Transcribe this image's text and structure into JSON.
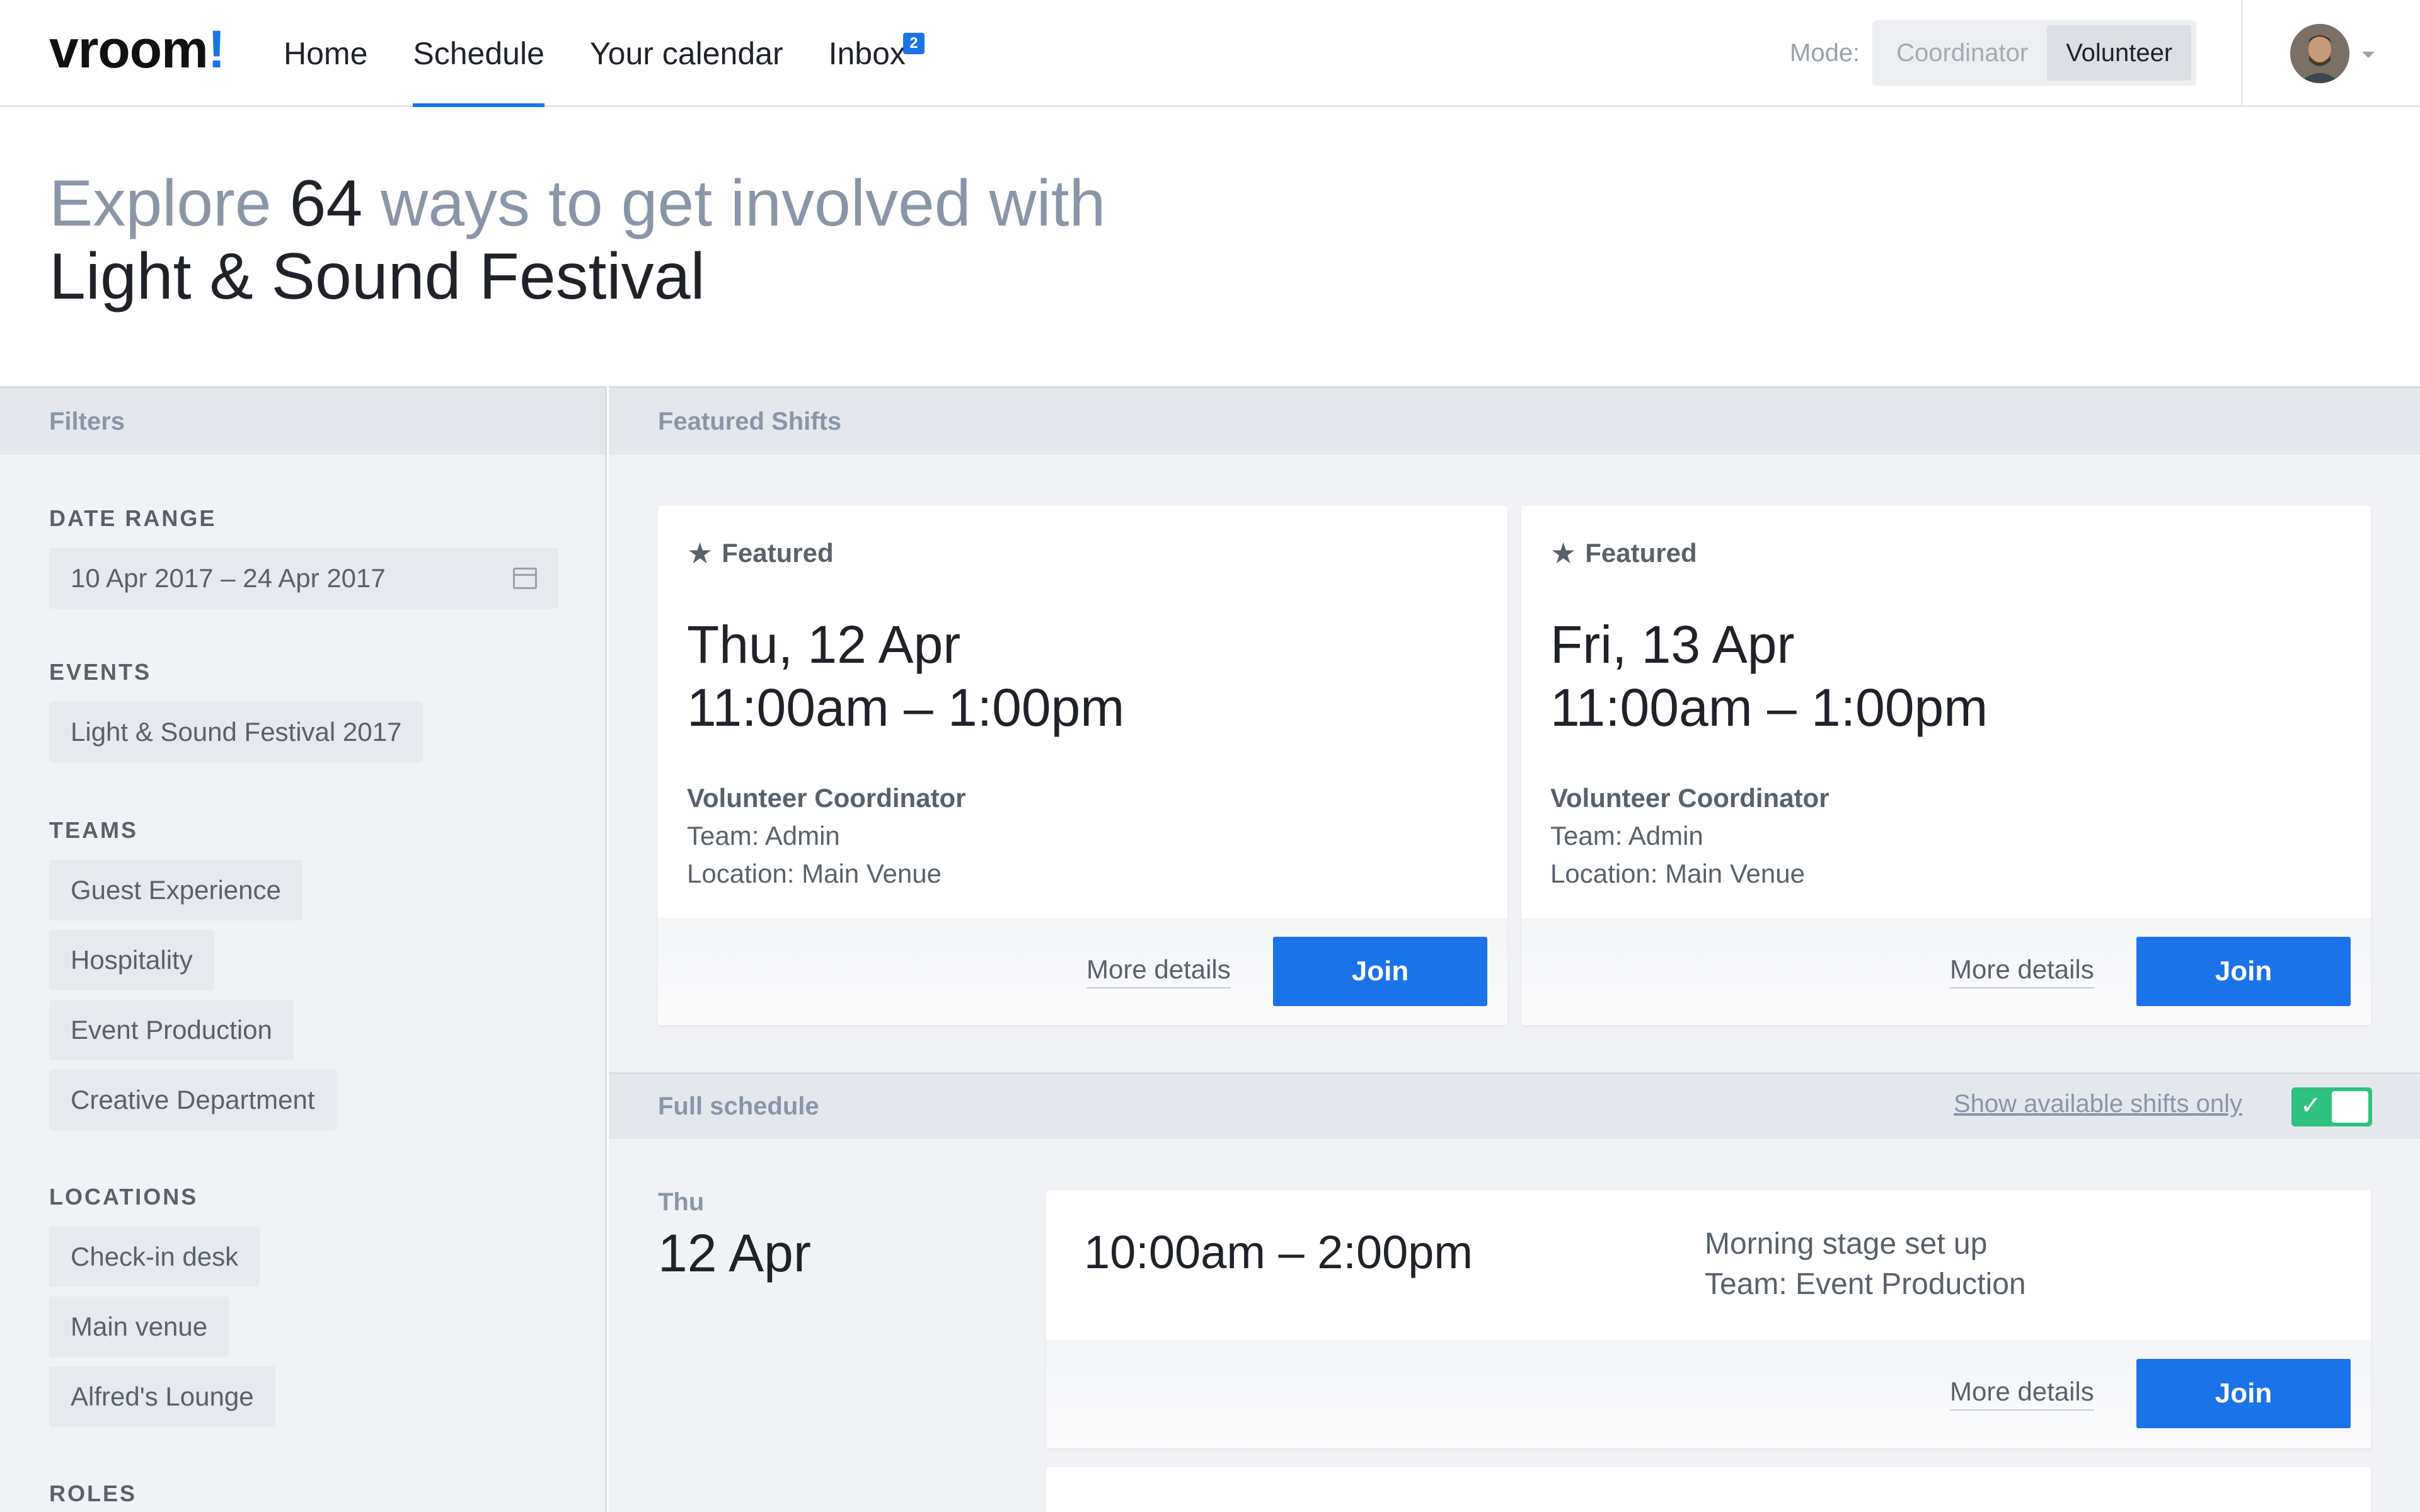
{
  "app": {
    "logo": "vroom",
    "logo_mark": "!"
  },
  "nav": {
    "items": [
      {
        "label": "Home"
      },
      {
        "label": "Schedule",
        "active": true
      },
      {
        "label": "Your calendar"
      },
      {
        "label": "Inbox",
        "badge": "2"
      }
    ]
  },
  "mode": {
    "label": "Mode:",
    "options": [
      "Coordinator",
      "Volunteer"
    ],
    "selected": "Volunteer"
  },
  "hero": {
    "prefix": "Explore ",
    "count": "64",
    "suffix": " ways to get involved with",
    "event_name": "Light & Sound Festival"
  },
  "filters": {
    "header": "Filters",
    "date_range": {
      "title": "DATE RANGE",
      "value": "10 Apr 2017 – 24 Apr 2017"
    },
    "events": {
      "title": "EVENTS",
      "items": [
        "Light & Sound Festival 2017"
      ]
    },
    "teams": {
      "title": "TEAMS",
      "items": [
        "Guest Experience",
        "Hospitality",
        "Event Production",
        "Creative Department"
      ]
    },
    "locations": {
      "title": "LOCATIONS",
      "items": [
        "Check-in desk",
        "Main venue",
        "Alfred's Lounge"
      ]
    },
    "roles": {
      "title": "ROLES"
    }
  },
  "featured": {
    "header": "Featured Shifts",
    "cards": [
      {
        "badge": "Featured",
        "date": "Thu, 12 Apr",
        "time": "11:00am – 1:00pm",
        "role": "Volunteer Coordinator",
        "team": "Team: Admin",
        "location": "Location: Main Venue",
        "more": "More details",
        "join": "Join"
      },
      {
        "badge": "Featured",
        "date": "Fri, 13 Apr",
        "time": "11:00am – 1:00pm",
        "role": "Volunteer Coordinator",
        "team": "Team: Admin",
        "location": "Location: Main Venue",
        "more": "More details",
        "join": "Join"
      }
    ]
  },
  "schedule": {
    "header": "Full schedule",
    "available_only_label": "Show available shifts only",
    "available_only": true,
    "day": {
      "weekday": "Thu",
      "date": "12 Apr"
    },
    "shifts": [
      {
        "time": "10:00am – 2:00pm",
        "title": "Morning stage set up",
        "team": "Team: Event Production",
        "more": "More details",
        "join": "Join"
      }
    ]
  },
  "colors": {
    "accent": "#1a73e8",
    "toggle_on": "#2ec27e"
  }
}
